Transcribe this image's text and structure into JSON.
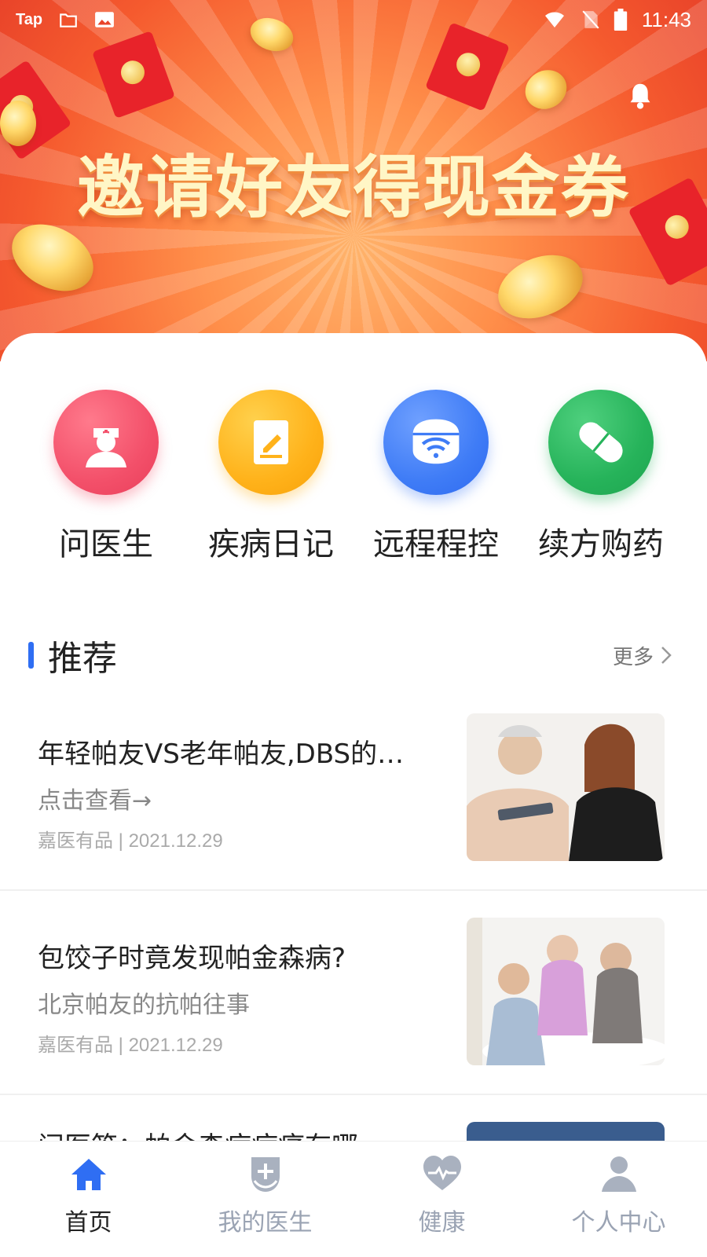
{
  "status_bar": {
    "app_label": "Tap",
    "time": "11:43"
  },
  "banner": {
    "title": "邀请好友得现金券"
  },
  "services": [
    {
      "label": "问医生",
      "icon": "doctor-icon",
      "color": "#f3506a"
    },
    {
      "label": "疾病日记",
      "icon": "diary-icon",
      "color": "#ffb21a"
    },
    {
      "label": "远程程控",
      "icon": "remote-control-icon",
      "color": "#3f7cf6"
    },
    {
      "label": "续方购药",
      "icon": "pill-icon",
      "color": "#26b35a"
    }
  ],
  "recommend": {
    "title": "推荐",
    "more_label": "更多",
    "accent_color": "#2f6ef3"
  },
  "articles": [
    {
      "title": "年轻帕友VS老年帕友,DBS的长…",
      "subtitle": "点击查看→",
      "meta": "嘉医有品 | 2021.12.29"
    },
    {
      "title": "包饺子时竟发现帕金森病?",
      "subtitle": "北京帕友的抗帕往事",
      "meta": "嘉医有品 | 2021.12.29"
    },
    {
      "title": "问医答：帕金森病病痛有哪",
      "subtitle": "",
      "meta": ""
    }
  ],
  "tabs": [
    {
      "label": "首页",
      "icon": "home-icon",
      "active": true
    },
    {
      "label": "我的医生",
      "icon": "doctor-badge-icon",
      "active": false
    },
    {
      "label": "健康",
      "icon": "heart-pulse-icon",
      "active": false
    },
    {
      "label": "个人中心",
      "icon": "person-icon",
      "active": false
    }
  ]
}
